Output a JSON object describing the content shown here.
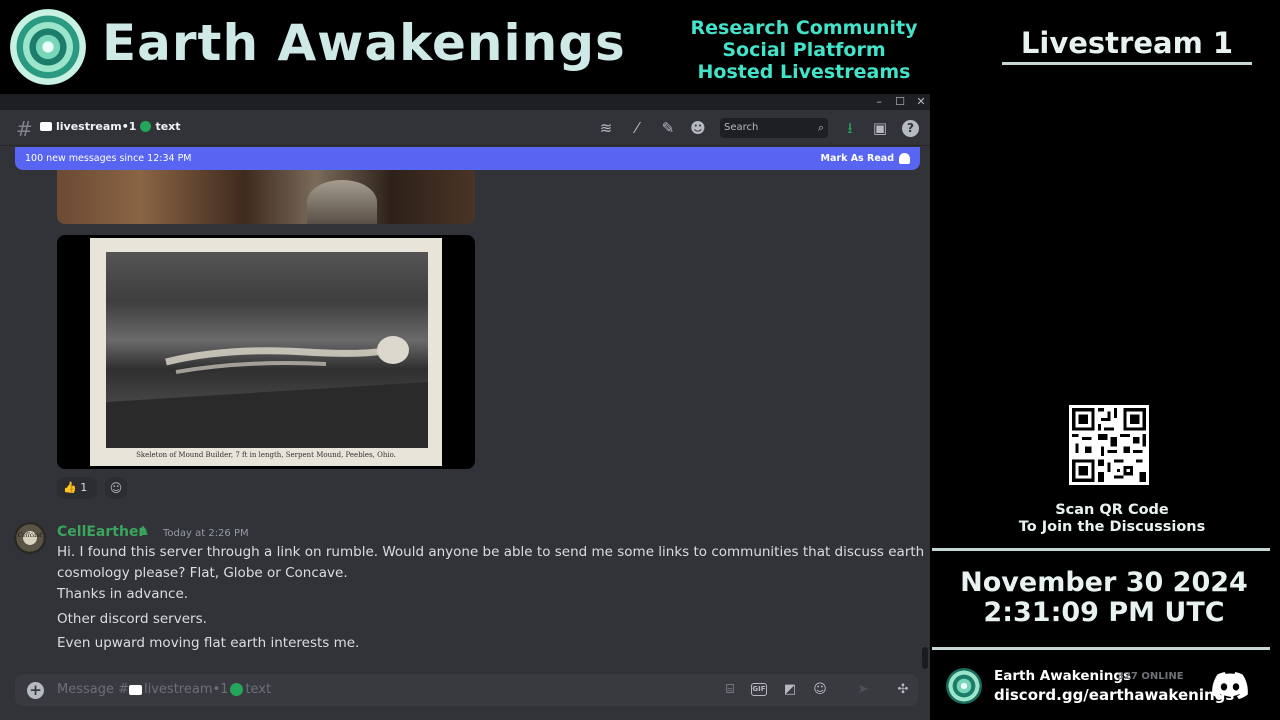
{
  "banner": {
    "brand": "Earth Awakenings",
    "taglines": [
      "Research Community",
      "Social Platform",
      "Hosted Livestreams"
    ]
  },
  "right_panel": {
    "title": "Livestream 1",
    "scan_line1": "Scan QR Code",
    "scan_line2": "To Join the Discussions",
    "date": "November 30 2024",
    "time": "2:31:09 PM UTC",
    "server_name": "Earth Awakenings",
    "online": "327 ONLINE",
    "invite": "discord.gg/earthawakenings"
  },
  "window": {
    "controls": [
      "–",
      "☐",
      "✕"
    ],
    "channel_pre": "livestream•1",
    "channel_post": "text",
    "search_placeholder": "Search",
    "new_messages": "100 new messages since 12:34 PM",
    "mark_as_read": "Mark As Read",
    "image_caption": "Skeleton of Mound Builder, 7 ft  in length, Serpent Mound,       Peebles, Ohio.",
    "reaction_emoji": "👍",
    "reaction_count": "1",
    "author": "CellEarther",
    "avatar_text": "Cellcast",
    "timestamp": "Today at 2:26 PM",
    "messages": [
      "Hi. I found this server through a link on rumble. Would anyone be able to send me some links to communities that discuss earth",
      "cosmology please? Flat, Globe or Concave.",
      "Thanks in advance.",
      "Other discord servers.",
      "Even upward moving flat earth interests me."
    ],
    "composer_pre": "Message #",
    "composer_channel": "livestream•1",
    "composer_post": "text",
    "gif_label": "GIF"
  },
  "colors": {
    "accent": "#5865f2",
    "online_dot": "#23a55a",
    "username": "#3ba55d",
    "tagline": "#42e3c8"
  },
  "icons": [
    "threads-icon",
    "mute-icon",
    "pin-icon",
    "members-icon",
    "search-icon",
    "download-icon",
    "inbox-icon",
    "help-icon",
    "gift-icon",
    "gif-icon",
    "sticker-icon",
    "emoji-icon",
    "send-icon",
    "apps-icon",
    "discord-logo-icon",
    "qr-code"
  ]
}
